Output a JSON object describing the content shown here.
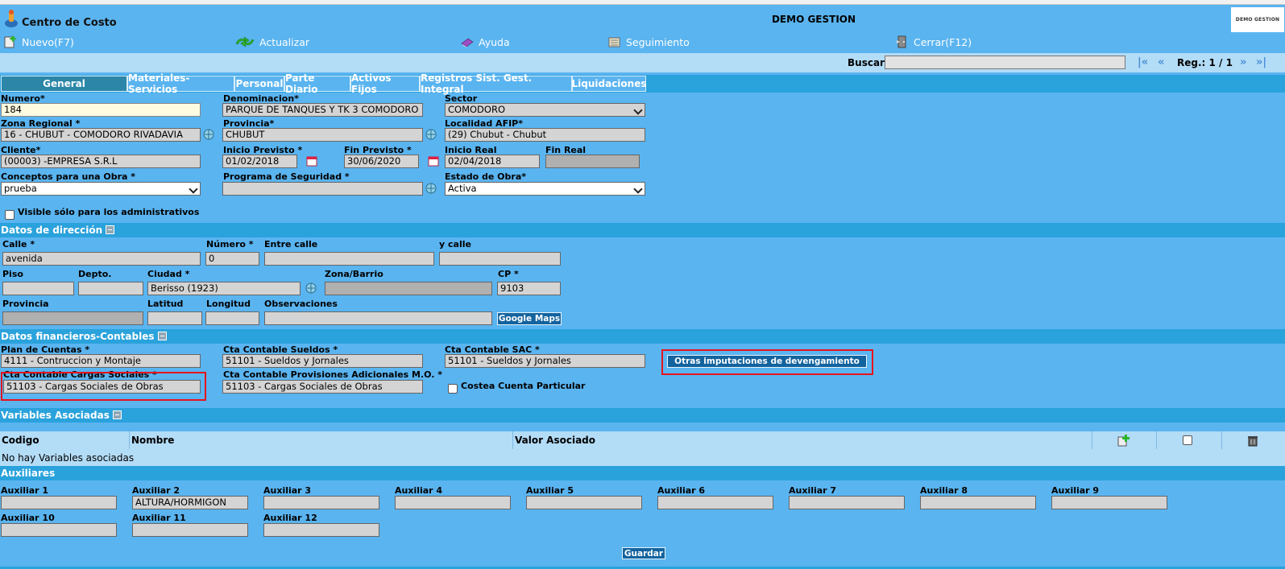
{
  "header": {
    "app_title": "Centro de Costo",
    "center_title": "DEMO GESTION",
    "logo_text": "DEMO GESTION"
  },
  "toolbar": {
    "nuevo": "Nuevo(F7)",
    "actualizar": "Actualizar",
    "ayuda": "Ayuda",
    "seguimiento": "Seguimiento",
    "cerrar": "Cerrar(F12)"
  },
  "search": {
    "label": "Buscar",
    "value": "",
    "first": "|«",
    "prev": "«",
    "reg": "Reg.: 1 / 1",
    "next": "»",
    "last": "»|"
  },
  "tabs": [
    "General",
    "Materiales-Servicios",
    "Personal",
    "Parte Diario",
    "Activos Fijos",
    "Registros Sist. Gest. Integral",
    "Liquidaciones"
  ],
  "general": {
    "numero_label": "Numero*",
    "numero": "184",
    "denominacion_label": "Denominacion*",
    "denominacion": "PARQUE DE TANQUES Y TK 3 COMODORO",
    "sector_label": "Sector",
    "sector": "COMODORO",
    "zona_label": "Zona Regional *",
    "zona": "16 - CHUBUT - COMODORO RIVADAVIA",
    "provincia_label": "Provincia*",
    "provincia": "CHUBUT",
    "localidad_label": "Localidad AFIP*",
    "localidad": "(29) Chubut - Chubut",
    "cliente_label": "Cliente*",
    "cliente": "(00003) -EMPRESA S.R.L",
    "inicio_prev_label": "Inicio Previsto *",
    "inicio_prev": "01/02/2018",
    "fin_prev_label": "Fin Previsto *",
    "fin_prev": "30/06/2020",
    "inicio_real_label": "Inicio Real",
    "inicio_real": "02/04/2018",
    "fin_real_label": "Fin Real",
    "fin_real": "",
    "conceptos_label": "Conceptos para una Obra *",
    "conceptos": "prueba",
    "programa_label": "Programa de Seguridad *",
    "programa": "",
    "estado_label": "Estado de Obra*",
    "estado": "Activa",
    "visible_label": "Visible sólo para los administrativos"
  },
  "direccion": {
    "title": "Datos de dirección",
    "calle_label": "Calle *",
    "calle": "avenida",
    "numero_label": "Número *",
    "numero": "0",
    "entre_label": "Entre calle",
    "entre": "",
    "ycalle_label": "y calle",
    "ycalle": "",
    "piso_label": "Piso",
    "piso": "",
    "depto_label": "Depto.",
    "depto": "",
    "ciudad_label": "Ciudad *",
    "ciudad": "Berisso (1923)",
    "zona_label": "Zona/Barrio",
    "zona": "",
    "cp_label": "CP *",
    "cp": "9103",
    "provincia_label": "Provincia",
    "provincia": "",
    "latitud_label": "Latitud",
    "latitud": "",
    "longitud_label": "Longitud",
    "longitud": "",
    "obs_label": "Observaciones",
    "obs": "",
    "maps_btn": "Google Maps"
  },
  "financieros": {
    "title": "Datos financieros-Contables",
    "plan_label": "Plan de Cuentas *",
    "plan": "4111 - Contruccion y Montaje",
    "sueldos_label": "Cta Contable Sueldos *",
    "sueldos": "51101 - Sueldos y Jornales",
    "sac_label": "Cta Contable SAC *",
    "sac": "51101 - Sueldos y Jornales",
    "otras_btn": "Otras imputaciones de devengamiento",
    "cargas_label": "Cta Contable Cargas Sociales *",
    "cargas": "51103 - Cargas Sociales de Obras",
    "provisiones_label": "Cta Contable Provisiones Adicionales M.O. *",
    "provisiones": "51103 - Cargas Sociales de Obras",
    "costea_label": "Costea Cuenta Particular"
  },
  "variables": {
    "title": "Variables Asociadas",
    "col_codigo": "Codigo",
    "col_nombre": "Nombre",
    "col_valor": "Valor Asociado",
    "empty": "No hay Variables asociadas"
  },
  "auxiliares": {
    "title": "Auxiliares",
    "items": [
      {
        "label": "Auxiliar 1",
        "value": ""
      },
      {
        "label": "Auxiliar 2",
        "value": "ALTURA/HORMIGON"
      },
      {
        "label": "Auxiliar 3",
        "value": ""
      },
      {
        "label": "Auxiliar 4",
        "value": ""
      },
      {
        "label": "Auxiliar 5",
        "value": ""
      },
      {
        "label": "Auxiliar 6",
        "value": ""
      },
      {
        "label": "Auxiliar 7",
        "value": ""
      },
      {
        "label": "Auxiliar 8",
        "value": ""
      },
      {
        "label": "Auxiliar 9",
        "value": ""
      },
      {
        "label": "Auxiliar 10",
        "value": ""
      },
      {
        "label": "Auxiliar 11",
        "value": ""
      },
      {
        "label": "Auxiliar 12",
        "value": ""
      }
    ],
    "save_btn": "Guardar"
  },
  "colors": {
    "bg": "#5ab4f0",
    "section": "#2aa2dc",
    "light": "#b3dcf7",
    "tab_active": "#2b86a8",
    "button": "#13639e",
    "highlight": "#e8131b"
  }
}
